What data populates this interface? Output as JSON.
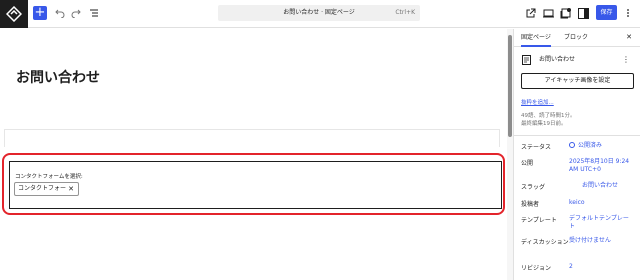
{
  "toolbar": {
    "add_label": "+",
    "command_title": "お問い合わせ · 固定ページ",
    "command_shortcut": "Ctrl+K",
    "save_label": "保存"
  },
  "editor": {
    "page_title": "お問い合わせ",
    "form_block": {
      "label": "コンタクトフォームを選択:",
      "selected_value": "コンタクトフォー",
      "remove_glyph": "✕"
    }
  },
  "sidebar": {
    "tabs": [
      {
        "label": "固定ページ",
        "active": true
      },
      {
        "label": "ブロック",
        "active": false
      }
    ],
    "close_glyph": "✕",
    "page_name": "お問い合わせ",
    "more_glyph": "⋮",
    "featured_image_button": "アイキャッチ画像を設定",
    "add_excerpt_link": "抜粋を追加...",
    "meta_line1": "49語、読了時間1分。",
    "meta_line2": "最終編集19日前。",
    "properties": [
      {
        "label": "ステータス",
        "value": "公開済み"
      },
      {
        "label": "公開",
        "value": "2025年8月10日 9:24 AM UTC+0"
      },
      {
        "label": "スラッグ",
        "value": "お問い合わせ"
      },
      {
        "label": "投稿者",
        "value": "keico"
      },
      {
        "label": "テンプレート",
        "value": "デフォルトテンプレート"
      },
      {
        "label": "ディスカッション",
        "value": "受け付けません"
      },
      {
        "label": "リビジョン",
        "value": "2"
      }
    ]
  },
  "colors": {
    "accent": "#3858e9",
    "highlight": "#e3242b",
    "dark": "#1e1e1e"
  }
}
